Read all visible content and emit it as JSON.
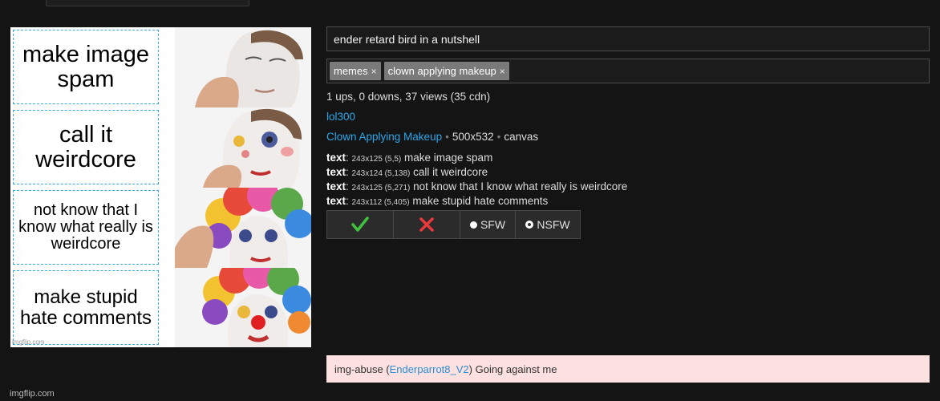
{
  "meme": {
    "panels": [
      {
        "text": "make image spam"
      },
      {
        "text": "call it weirdcore"
      },
      {
        "text": "not know that I know what really is weirdcore"
      },
      {
        "text": "make stupid hate comments"
      }
    ],
    "watermark": "imgflip.com"
  },
  "footer": {
    "site": "imgflip.com"
  },
  "editor": {
    "title_value": "ender retard bird in a nutshell",
    "tags": [
      {
        "label": "memes",
        "remove": "×"
      },
      {
        "label": "clown applying makeup",
        "remove": "×"
      }
    ],
    "stats": "1 ups, 0 downs, 37 views (35 cdn)",
    "username": "lol300",
    "template_name": "Clown Applying Makeup",
    "dimensions": "500x532",
    "canvas": "canvas",
    "sep": "•",
    "text_boxes": [
      {
        "key": "text",
        "meta": "243x125 (5,5)",
        "value": "make image spam"
      },
      {
        "key": "text",
        "meta": "243x124 (5,138)",
        "value": "call it weirdcore"
      },
      {
        "key": "text",
        "meta": "243x125 (5,271)",
        "value": "not know that I know what really is weirdcore"
      },
      {
        "key": "text",
        "meta": "243x112 (5,405)",
        "value": "make stupid hate comments"
      }
    ],
    "moderation": {
      "approve_icon": "check-icon",
      "reject_icon": "x-icon",
      "sfw_label": "SFW",
      "nsfw_label": "NSFW",
      "selected": "NSFW",
      "approve_color": "#3fc33f",
      "reject_color": "#e83a3a"
    },
    "report": {
      "prefix": "img-abuse (",
      "user": "Enderparrot8_V2",
      "suffix": ") Going against me",
      "background": "#fde0e0"
    }
  }
}
